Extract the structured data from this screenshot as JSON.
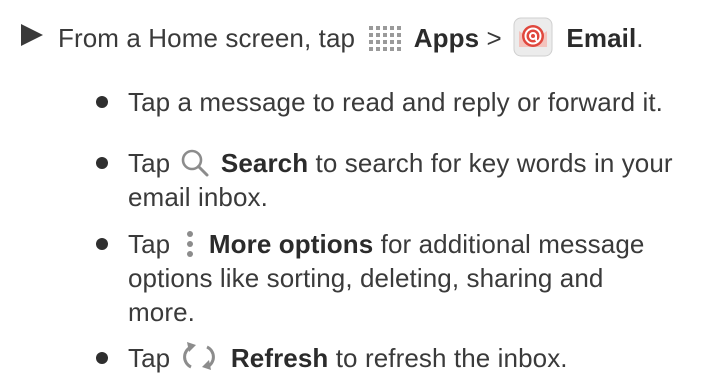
{
  "step": {
    "text_1": "From a Home screen, tap",
    "apps_label": "Apps",
    "separator": ">",
    "email_label": "Email",
    "end": "."
  },
  "bullets": {
    "b1": "Tap a message to read and reply or forward it.",
    "b2": {
      "tap": "Tap",
      "label": "Search",
      "line1_rest": "to search for key words in your",
      "line2": "email inbox."
    },
    "b3": {
      "tap": "Tap",
      "label": "More options",
      "line1_rest": "for additional message",
      "line2": "options like sorting, deleting, sharing and",
      "line3": "more."
    },
    "b4": {
      "tap": "Tap",
      "label": "Refresh",
      "rest": "to refresh the inbox."
    }
  },
  "icons": {
    "apps": "apps-grid-icon",
    "email": "email-app-icon",
    "search": "search-icon",
    "more": "more-options-icon",
    "refresh": "refresh-icon"
  },
  "colors": {
    "text": "#3a3a3a",
    "icon_gray": "#8c8c8c",
    "email_red": "#d9453b",
    "email_bg": "#e8e8e8"
  }
}
